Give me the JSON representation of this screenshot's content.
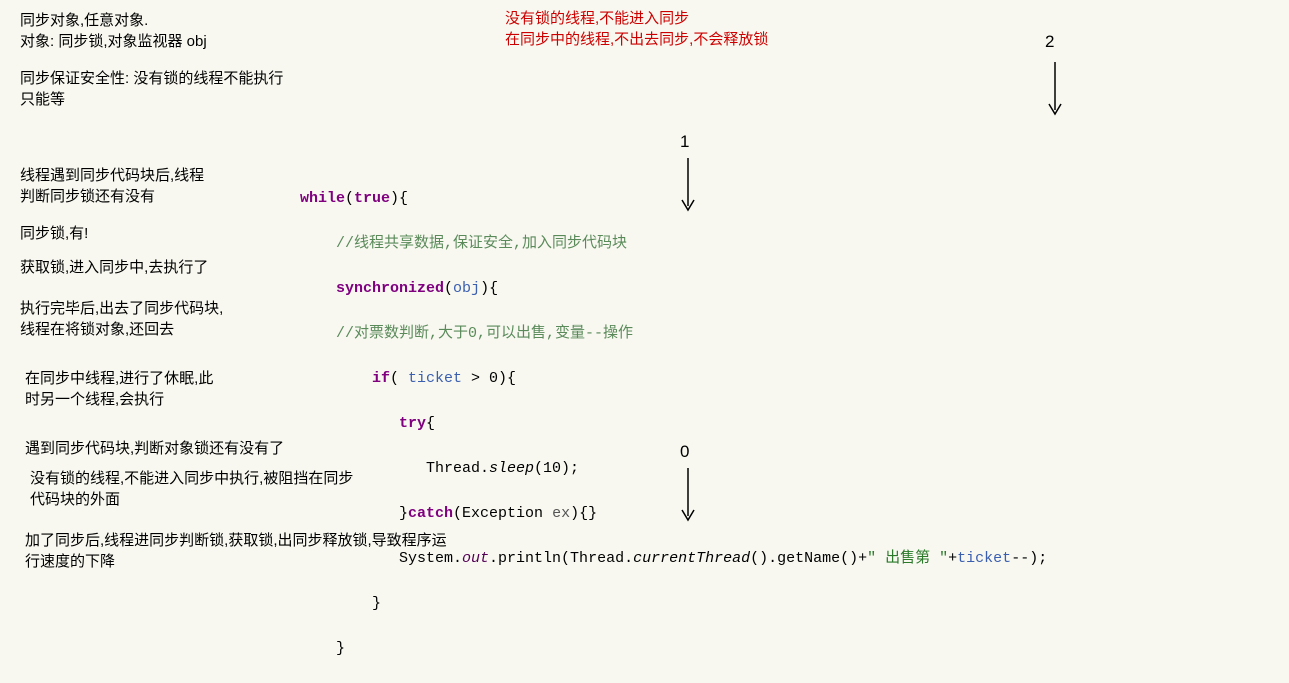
{
  "left": {
    "l1a": "同步对象,任意对象.",
    "l1b": "对象: 同步锁,对象监视器 obj",
    "l2a": "同步保证安全性: 没有锁的线程不能执行",
    "l2b": "只能等",
    "l3a": "线程遇到同步代码块后,线程",
    "l3b": "判断同步锁还有没有",
    "l4": "同步锁,有!",
    "l5": "获取锁,进入同步中,去执行了",
    "l6a": "执行完毕后,出去了同步代码块,",
    "l6b": "线程在将锁对象,还回去",
    "l7a": "在同步中线程,进行了休眠,此",
    "l7b": "时另一个线程,会执行",
    "l8": "遇到同步代码块,判断对象锁还有没有了",
    "l9a": "没有锁的线程,不能进入同步中执行,被阻挡在同步",
    "l9b": "代码块的外面",
    "l10a": "加了同步后,线程进同步判断锁,获取锁,出同步释放锁,导致程序运",
    "l10b": "行速度的下降"
  },
  "top_red": {
    "r1": "没有锁的线程,不能进入同步",
    "r2": "在同步中的线程,不出去同步,不会释放锁"
  },
  "code": {
    "c0a": "while",
    "c0b": "(",
    "c0c": "true",
    "c0d": "){",
    "c1": "    //线程共享数据,保证安全,加入同步代码块",
    "c2a": "    synchronized",
    "c2b": "(",
    "c2c": "obj",
    "c2d": "){",
    "c3": "    //对票数判断,大于0,可以出售,变量--操作",
    "c4a": "        if",
    "c4b": "( ",
    "c4c": "ticket",
    "c4d": " > 0){",
    "c5a": "           try",
    "c5b": "{",
    "c6a": "              Thread.",
    "c6b": "sleep",
    "c6c": "(10);",
    "c7a": "           }",
    "c7b": "catch",
    "c7c": "(Exception ",
    "c7d": "ex",
    "c7e": "){}",
    "c8a": "           System.",
    "c8b": "out",
    "c8c": ".println(Thread.",
    "c8d": "currentThread",
    "c8e": "().getName()+",
    "c8f": "\" 出售第 \"",
    "c8g": "+",
    "c8h": "ticket",
    "c8i": "--);",
    "c9": "        }",
    "c10": "    }"
  },
  "labels": {
    "n2": "2",
    "n1": "1",
    "n0": "0"
  }
}
